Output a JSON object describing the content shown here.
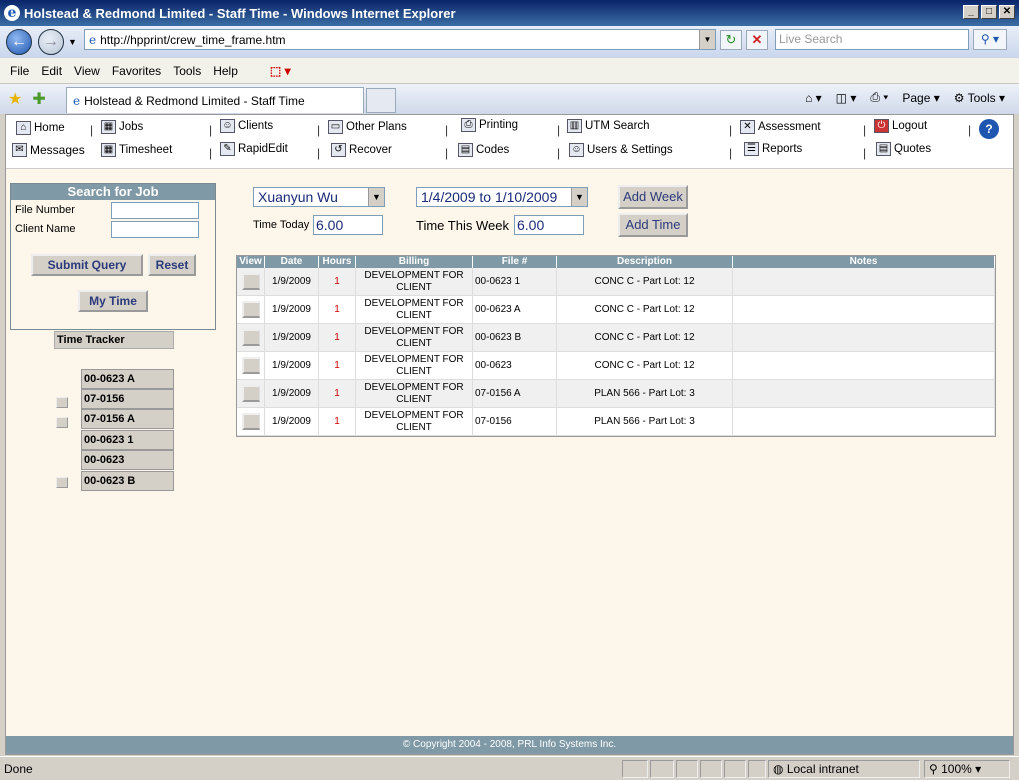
{
  "window": {
    "title": "Holstead & Redmond Limited - Staff Time - Windows Internet Explorer"
  },
  "address": {
    "url": "http://hpprint/crew_time_frame.htm",
    "search_placeholder": "Live Search"
  },
  "menu": [
    "File",
    "Edit",
    "View",
    "Favorites",
    "Tools",
    "Help"
  ],
  "tab": {
    "title": "Holstead & Redmond Limited - Staff Time"
  },
  "cmdbar": {
    "page": "Page",
    "tools": "Tools"
  },
  "nav": {
    "home": "Home",
    "jobs": "Jobs",
    "clients": "Clients",
    "other_plans": "Other Plans",
    "printing": "Printing",
    "utm_search": "UTM Search",
    "assessment": "Assessment",
    "logout": "Logout",
    "messages": "Messages",
    "timesheet": "Timesheet",
    "rapidedit": "RapidEdit",
    "recover": "Recover",
    "codes": "Codes",
    "users_settings": "Users & Settings",
    "reports": "Reports",
    "quotes": "Quotes"
  },
  "search": {
    "title": "Search for Job",
    "file_number_label": "File Number",
    "client_name_label": "Client Name",
    "submit": "Submit Query",
    "reset": "Reset",
    "my_time": "My Time"
  },
  "tracker": {
    "title": "Time Tracker",
    "items": [
      "00-0623 A",
      "07-0156",
      "07-0156 A",
      "00-0623 1",
      "00-0623",
      "00-0623 B"
    ]
  },
  "form": {
    "employee": "Xuanyun Wu",
    "week": "1/4/2009 to 1/10/2009",
    "add_week": "Add Week",
    "add_time": "Add Time",
    "time_today_label": "Time Today",
    "time_today": "6.00",
    "time_week_label": "Time This Week",
    "time_week": "6.00"
  },
  "table": {
    "headers": [
      "View",
      "Date",
      "Hours",
      "Billing",
      "File #",
      "Description",
      "Notes"
    ],
    "rows": [
      {
        "date": "1/9/2009",
        "hours": "1",
        "billing": "DEVELOPMENT FOR CLIENT",
        "file": "00-0623 1",
        "desc": "CONC C - Part Lot: 12",
        "notes": ""
      },
      {
        "date": "1/9/2009",
        "hours": "1",
        "billing": "DEVELOPMENT FOR CLIENT",
        "file": "00-0623 A",
        "desc": "CONC C - Part Lot: 12",
        "notes": ""
      },
      {
        "date": "1/9/2009",
        "hours": "1",
        "billing": "DEVELOPMENT FOR CLIENT",
        "file": "00-0623 B",
        "desc": "CONC C - Part Lot: 12",
        "notes": ""
      },
      {
        "date": "1/9/2009",
        "hours": "1",
        "billing": "DEVELOPMENT FOR CLIENT",
        "file": "00-0623",
        "desc": "CONC C - Part Lot: 12",
        "notes": ""
      },
      {
        "date": "1/9/2009",
        "hours": "1",
        "billing": "DEVELOPMENT FOR CLIENT",
        "file": "07-0156 A",
        "desc": "PLAN 566 - Part Lot: 3",
        "notes": ""
      },
      {
        "date": "1/9/2009",
        "hours": "1",
        "billing": "DEVELOPMENT FOR CLIENT",
        "file": "07-0156",
        "desc": "PLAN 566 - Part Lot: 3",
        "notes": ""
      }
    ]
  },
  "footer": "© Copyright 2004 - 2008, PRL Info Systems Inc.",
  "status": {
    "left": "Done",
    "zone": "Local intranet",
    "zoom": "100%"
  }
}
